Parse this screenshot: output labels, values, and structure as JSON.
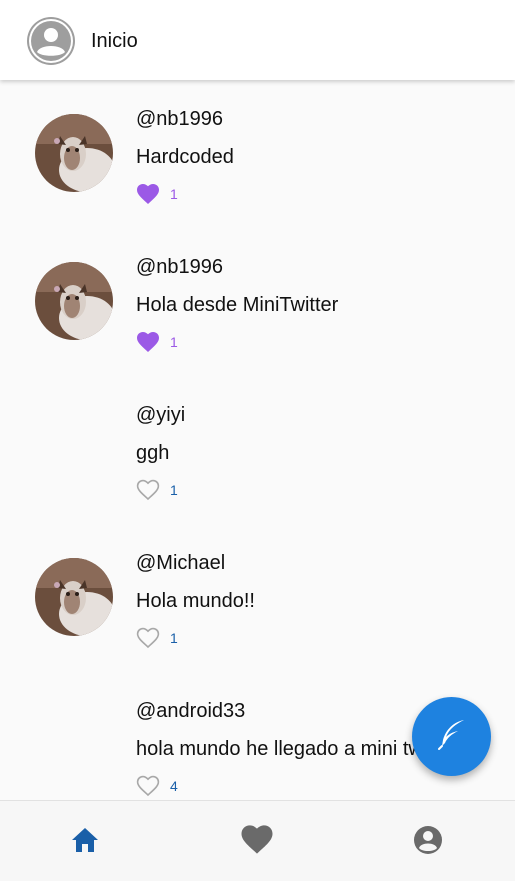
{
  "appbar": {
    "title": "Inicio"
  },
  "tweets": [
    {
      "username": "@nb1996",
      "text": "Hardcoded",
      "likes": "1",
      "liked": true,
      "has_avatar": true
    },
    {
      "username": "@nb1996",
      "text": "Hola desde MiniTwitter",
      "likes": "1",
      "liked": true,
      "has_avatar": true
    },
    {
      "username": "@yiyi",
      "text": "ggh",
      "likes": "1",
      "liked": false,
      "has_avatar": false
    },
    {
      "username": "@Michael",
      "text": "Hola mundo!!",
      "likes": "1",
      "liked": false,
      "has_avatar": true
    },
    {
      "username": "@android33",
      "text": "hola mundo he llegado a mini tw",
      "likes": "4",
      "liked": false,
      "has_avatar": false
    }
  ],
  "colors": {
    "liked": "#9b59e6",
    "fab": "#1e82e0",
    "nav_active": "#1a5fa8",
    "nav_inactive": "#6a6a6a"
  },
  "icons": {
    "appbar_avatar": "account-circle-icon",
    "like_filled": "heart-filled-icon",
    "like_outline": "heart-outline-icon",
    "fab": "feather-icon",
    "nav": [
      "home-icon",
      "heart-icon",
      "account-circle-icon"
    ]
  },
  "bottom_nav": {
    "active_index": 0
  }
}
